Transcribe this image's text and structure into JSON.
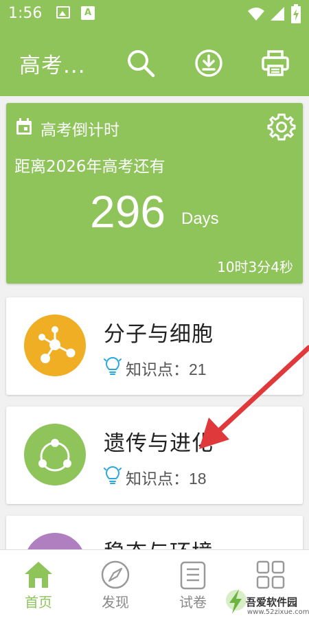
{
  "status_bar": {
    "time": "1:56",
    "small_icon_letter": "A"
  },
  "app_bar": {
    "title": "高考..."
  },
  "countdown": {
    "title": "高考倒计时",
    "subtitle": "距离2026年高考还有",
    "days": "296",
    "days_unit": "Days",
    "remaining": "10时3分4秒"
  },
  "cards": [
    {
      "title": "分子与细胞",
      "kp_label": "知识点：",
      "kp_count": "21",
      "color": "#f0ae24"
    },
    {
      "title": "遗传与进化",
      "kp_label": "知识点：",
      "kp_count": "18",
      "color": "#8ec45a"
    },
    {
      "title": "稳态与环境",
      "color": "#b07fc0"
    }
  ],
  "bottom_nav": [
    {
      "label": "首页",
      "icon": "home-icon",
      "active": true
    },
    {
      "label": "发现",
      "icon": "compass-icon",
      "active": false
    },
    {
      "label": "试卷",
      "icon": "document-icon",
      "active": false
    },
    {
      "label": "",
      "icon": "grid-icon",
      "active": false
    }
  ],
  "watermark": {
    "text": "吾爱软件园",
    "url": "www.52zixue.com"
  },
  "colors": {
    "primary": "#8ec45a",
    "accent_orange": "#f0ae24",
    "accent_purple": "#b07fc0",
    "arrow_red": "#e0393b",
    "bulb_blue": "#29a8dd"
  }
}
